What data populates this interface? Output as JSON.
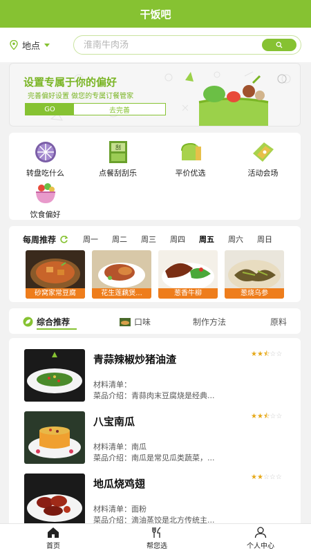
{
  "header": {
    "title": "干饭吧"
  },
  "location": {
    "label": "地点",
    "icon": "location-pin-icon"
  },
  "search": {
    "placeholder": "淮南牛肉汤",
    "button_icon": "search-icon"
  },
  "banner": {
    "title": "设置专属于你的偏好",
    "subtitle": "完善偏好设置 做您的专属订餐管家",
    "go_label": "GO",
    "later_label": "去完善"
  },
  "categories": [
    {
      "label": "转盘吃什么",
      "icon": "wheel-icon"
    },
    {
      "label": "点餐刮刮乐",
      "icon": "scratch-card-icon"
    },
    {
      "label": "平价优选",
      "icon": "bread-icon"
    },
    {
      "label": "活动会场",
      "icon": "ticket-icon"
    },
    {
      "label": "饮食偏好",
      "icon": "salad-bowl-icon"
    }
  ],
  "weekly": {
    "title": "每周推荐",
    "days": [
      "周一",
      "周二",
      "周三",
      "周四",
      "周五",
      "周六",
      "周日"
    ],
    "active_day": "周五",
    "dishes": [
      {
        "label": "砂窝家常豆腐"
      },
      {
        "label": "花生莲藕煲..."
      },
      {
        "label": "葱香牛柳"
      },
      {
        "label": "葱烧乌参"
      }
    ]
  },
  "tabs": [
    {
      "label": "综合推荐",
      "active": true
    },
    {
      "label": "口味",
      "active": false
    },
    {
      "label": "制作方法",
      "active": false
    },
    {
      "label": "原料",
      "active": false
    }
  ],
  "list": [
    {
      "name": "青蒜辣椒炒猪油渣",
      "materials": "材料清单：",
      "intro": "菜品介绍：青蒜肉末豆腐烧是经典...",
      "rating": 2.5
    },
    {
      "name": "八宝南瓜",
      "materials": "材料清单：南瓜",
      "intro": "菜品介绍：南瓜是常见瓜类蔬菜，...",
      "rating": 2.5
    },
    {
      "name": "地瓜烧鸡翅",
      "materials": "材料清单：面粉",
      "intro": "菜品介绍：滴油蒸饺是北方传统主...",
      "rating": 2
    }
  ],
  "bottom_nav": [
    {
      "label": "首页",
      "icon": "home-icon"
    },
    {
      "label": "帮您选",
      "icon": "fork-knife-icon"
    },
    {
      "label": "个人中心",
      "icon": "user-icon"
    }
  ],
  "colors": {
    "brand": "#86c232",
    "orange": "#ee7d1c",
    "star": "#e6a817"
  }
}
